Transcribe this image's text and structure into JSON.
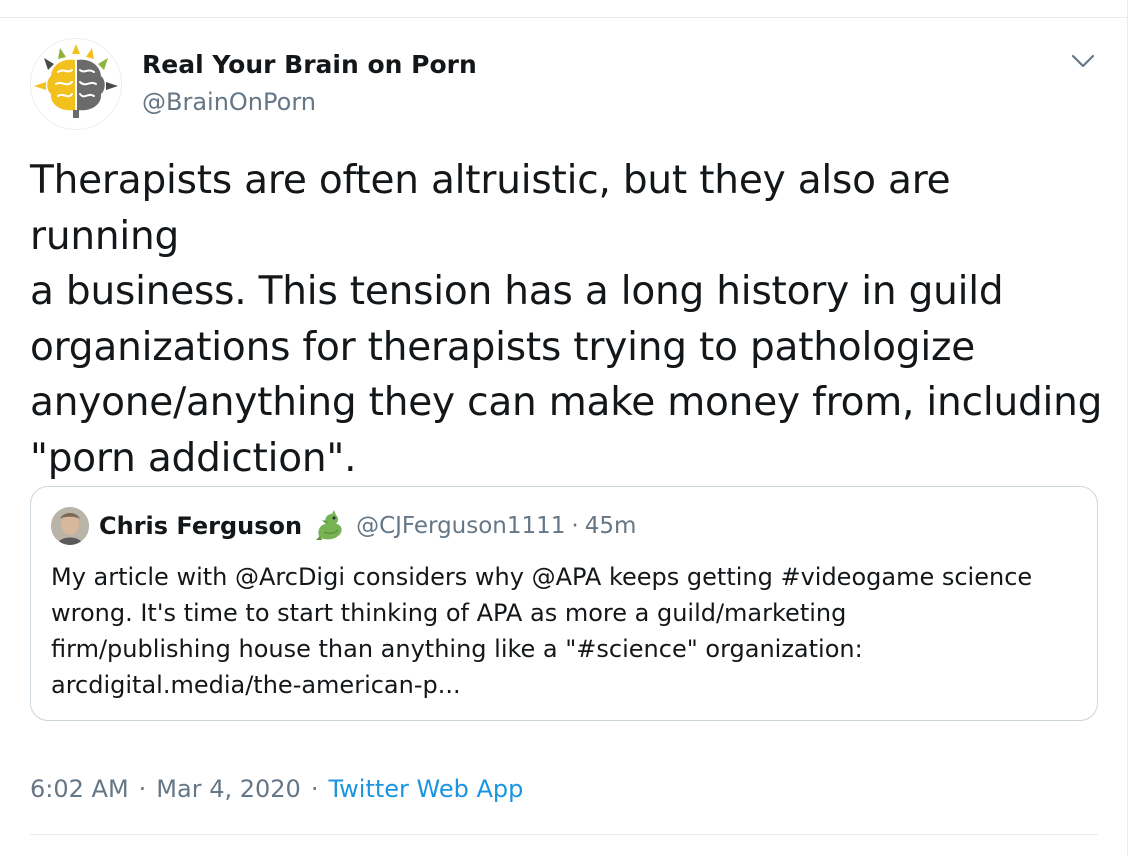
{
  "tweet": {
    "author": {
      "name": "Real Your Brain on Porn",
      "handle": "@BrainOnPorn",
      "avatar_icon": "brain-sun-logo-icon"
    },
    "menu_icon": "chevron-down-icon",
    "text": "Therapists are often altruistic, but they also are running\na business. This tension has a long history in guild\norganizations for therapists trying to pathologize\nanyone/anything they can make money from, including\n\"porn addiction\".",
    "quoted": {
      "name": "Chris Ferguson",
      "badge_icon": "dragon-emoji-icon",
      "handle": "@CJFerguson1111",
      "separator": "·",
      "time": "45m",
      "text": "My article with @ArcDigi considers why @APA keeps getting #videogame science\nwrong.  It's time to start thinking of APA as more a guild/marketing\nfirm/publishing house than anything like a \"#science\" organization:\narcdigital.media/the-american-p..."
    },
    "meta": {
      "time": "6:02 AM",
      "sep1": "·",
      "date": "Mar 4, 2020",
      "sep2": "·",
      "source": "Twitter Web App"
    }
  },
  "colors": {
    "text_primary": "#14171a",
    "text_secondary": "#657786",
    "link": "#1b95e0",
    "border": "#ccd6dd",
    "divider": "#e6ecf0",
    "brain_left": "#f2c11d",
    "brain_right": "#6b6b6b"
  }
}
